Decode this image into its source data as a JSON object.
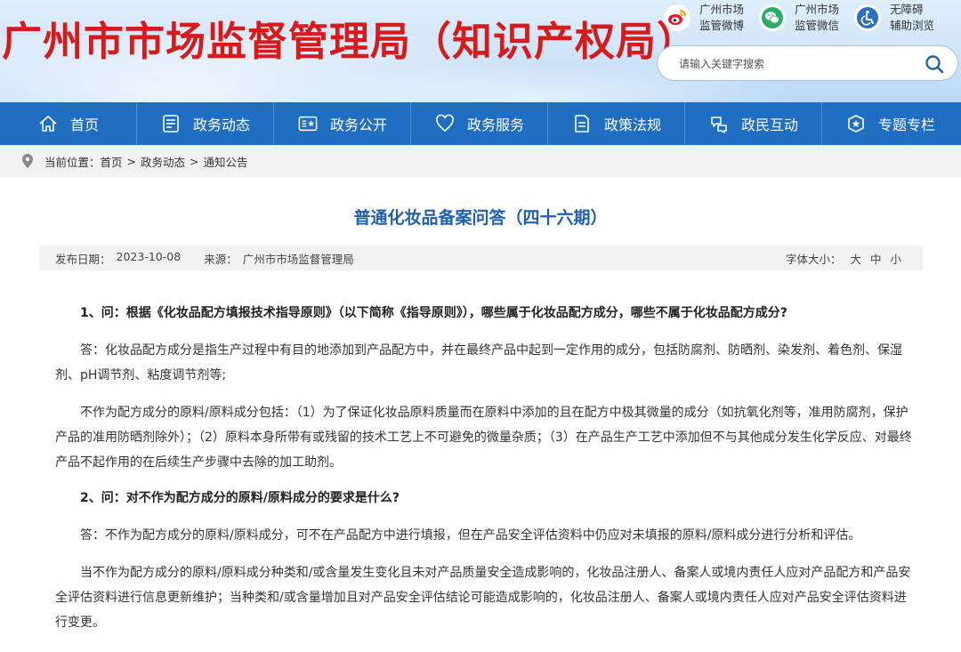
{
  "header": {
    "site_title": "广州市市场监督管理局（知识产权局）",
    "social": [
      {
        "icon": "weibo-icon",
        "label": "广州市场\n监管微博"
      },
      {
        "icon": "wechat-icon",
        "label": "广州市场\n监管微信"
      },
      {
        "icon": "accessibility-icon",
        "label": "无障碍\n辅助浏览"
      }
    ],
    "search": {
      "placeholder": "请输入关键字搜索",
      "value": ""
    }
  },
  "nav": [
    {
      "icon": "home-icon",
      "label": "首页"
    },
    {
      "icon": "news-icon",
      "label": "政务动态"
    },
    {
      "icon": "disclosure-icon",
      "label": "政务公开"
    },
    {
      "icon": "heart-icon",
      "label": "政务服务"
    },
    {
      "icon": "document-icon",
      "label": "政策法规"
    },
    {
      "icon": "interaction-icon",
      "label": "政民互动"
    },
    {
      "icon": "topic-icon",
      "label": "专题专栏"
    }
  ],
  "breadcrumb": {
    "prefix": "当前位置：",
    "items": [
      "首页",
      "政务动态",
      "通知公告"
    ],
    "separator": ">"
  },
  "article": {
    "title": "普通化妆品备案问答（四十六期）",
    "publish_label": "发布日期：",
    "publish_date": "2023-10-08",
    "source_label": "来源：",
    "source": "广州市市场监督管理局",
    "font_size_label": "字体大小：",
    "font_sizes": [
      "大",
      "中",
      "小"
    ],
    "paragraphs": [
      {
        "type": "q",
        "text": "1、问：根据《化妆品配方填报技术指导原则》（以下简称《指导原则》），哪些属于化妆品配方成分，哪些不属于化妆品配方成分?"
      },
      {
        "type": "a",
        "text": "答：化妆品配方成分是指生产过程中有目的地添加到产品配方中，并在最终产品中起到一定作用的成分，包括防腐剂、防晒剂、染发剂、着色剂、保湿剂、pH调节剂、粘度调节剂等;"
      },
      {
        "type": "a",
        "text": "不作为配方成分的原料/原料成分包括：（1）为了保证化妆品原料质量而在原料中添加的且在配方中极其微量的成分（如抗氧化剂等，准用防腐剂，保护产品的准用防晒剂除外）；（2）原料本身所带有或残留的技术工艺上不可避免的微量杂质；（3）在产品生产工艺中添加但不与其他成分发生化学反应、对最终产品不起作用的在后续生产步骤中去除的加工助剂。"
      },
      {
        "type": "q",
        "text": "2、问：对不作为配方成分的原料/原料成分的要求是什么?"
      },
      {
        "type": "a",
        "text": "答：不作为配方成分的原料/原料成分，可不在产品配方中进行填报，但在产品安全评估资料中仍应对未填报的原料/原料成分进行分析和评估。"
      },
      {
        "type": "a",
        "text": "当不作为配方成分的原料/原料成分种类和/或含量发生变化且未对产品质量安全造成影响的，化妆品注册人、备案人或境内责任人应对产品配方和产品安全评估资料进行信息更新维护；当种类和/或含量增加且对产品安全评估结论可能造成影响的，化妆品注册人、备案人或境内责任人应对产品安全评估资料进行变更。"
      }
    ]
  },
  "colors": {
    "title_red": "#d81a1a",
    "nav_blue": "#1f6ec2",
    "article_title_blue": "#1f5fb0"
  }
}
